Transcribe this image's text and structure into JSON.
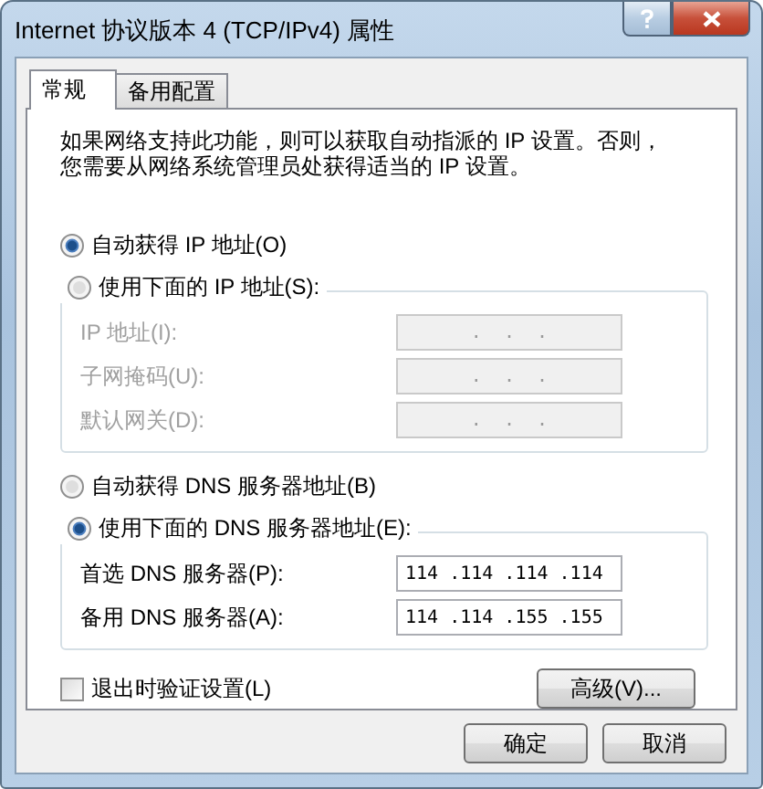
{
  "window": {
    "title": "Internet 协议版本 4 (TCP/IPv4) 属性"
  },
  "tabs": [
    {
      "label": "常规",
      "selected": true
    },
    {
      "label": "备用配置",
      "selected": false
    }
  ],
  "description": "如果网络支持此功能，则可以获取自动指派的 IP 设置。否则，您需要从网络系统管理员处获得适当的 IP 设置。",
  "sections": [
    {
      "auto": {
        "label": "自动获得 IP 地址(O)",
        "selected": true
      },
      "manual": {
        "label": "使用下面的 IP 地址(S):",
        "selected": false
      },
      "fields": [
        {
          "label": "IP 地址(I):",
          "value": ".  .  .",
          "disabled": true
        },
        {
          "label": "子网掩码(U):",
          "value": ".  .  .",
          "disabled": true
        },
        {
          "label": "默认网关(D):",
          "value": ".  .  .",
          "disabled": true
        }
      ]
    },
    {
      "auto": {
        "label": "自动获得 DNS 服务器地址(B)",
        "selected": false
      },
      "manual": {
        "label": "使用下面的 DNS 服务器地址(E):",
        "selected": true
      },
      "fields": [
        {
          "label": "首选 DNS 服务器(P):",
          "value": "114 .114 .114 .114",
          "disabled": false
        },
        {
          "label": "备用 DNS 服务器(A):",
          "value": "114 .114 .155 .155",
          "disabled": false
        }
      ]
    }
  ],
  "validate": {
    "label": "退出时验证设置(L)",
    "checked": false
  },
  "advanced_button": "高级(V)...",
  "buttons": [
    "确定",
    "取消"
  ]
}
